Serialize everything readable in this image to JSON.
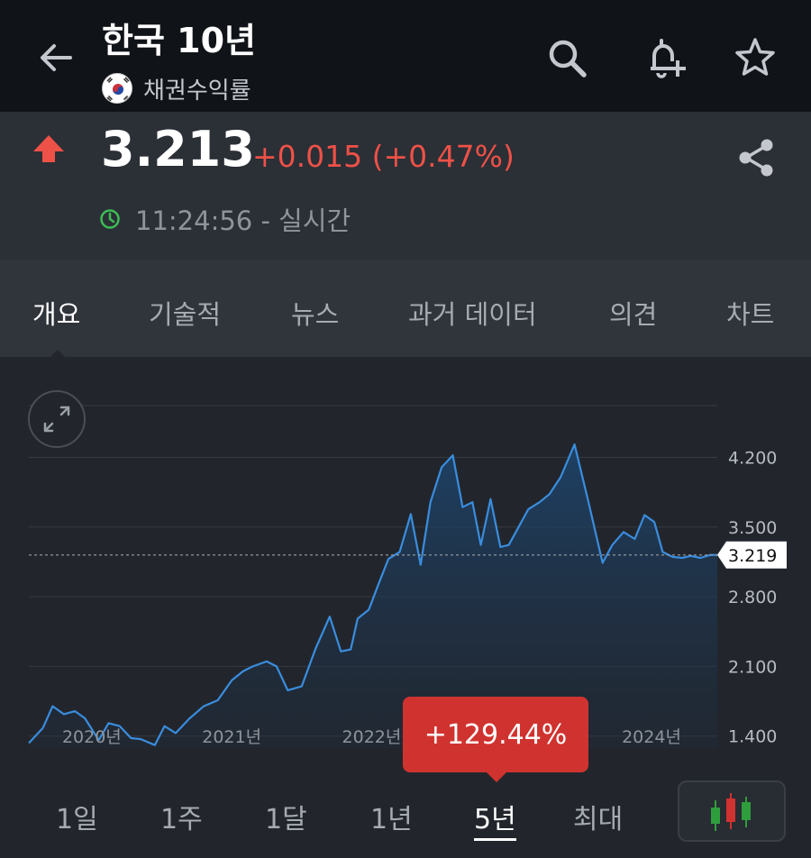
{
  "header": {
    "title": "한국 10년",
    "subtitle": "채권수익률",
    "icons": [
      "back-arrow-icon",
      "search-icon",
      "add-alert-icon",
      "star-icon"
    ]
  },
  "quote": {
    "price": "3.213",
    "change": "+0.015 (+0.47%)",
    "direction": "up",
    "time": "11:24:56 - 실시간",
    "colors": {
      "up": "#ee5147",
      "clock": "#3dbb55"
    }
  },
  "tabs": [
    "개요",
    "기술적",
    "뉴스",
    "과거 데이터",
    "의견",
    "차트"
  ],
  "active_tab": "개요",
  "ranges": [
    "1일",
    "1주",
    "1달",
    "1년",
    "5년",
    "최대"
  ],
  "active_range": "5년",
  "performance_badge": "+129.44%",
  "last_value_label": "3.219",
  "chart_data": {
    "type": "area",
    "x_tick_labels": [
      "2020년",
      "2021년",
      "2022년",
      "2024년"
    ],
    "y_tick_labels": [
      "4.200",
      "3.500",
      "2.800",
      "2.100",
      "1.400"
    ],
    "ylim": [
      1.28,
      4.72
    ],
    "xlim": [
      2019.55,
      2024.47
    ],
    "last_value": 3.219,
    "series": [
      {
        "x": [
          2019.55,
          2019.65,
          2019.72,
          2019.8,
          2019.88,
          2019.95,
          2020.05,
          2020.12,
          2020.2,
          2020.28,
          2020.35,
          2020.45,
          2020.52,
          2020.6,
          2020.7,
          2020.8,
          2020.9,
          2021.0,
          2021.08,
          2021.15,
          2021.25,
          2021.32,
          2021.4,
          2021.5,
          2021.6,
          2021.7,
          2021.78,
          2021.85,
          2021.9,
          2021.98,
          2022.05,
          2022.12,
          2022.2,
          2022.28,
          2022.35,
          2022.42,
          2022.5,
          2022.58,
          2022.65,
          2022.72,
          2022.78,
          2022.85,
          2022.92,
          2022.98,
          2023.05,
          2023.12,
          2023.2,
          2023.27,
          2023.35,
          2023.45,
          2023.55,
          2023.65,
          2023.72,
          2023.8,
          2023.88,
          2023.95,
          2024.02,
          2024.08,
          2024.15,
          2024.22,
          2024.28,
          2024.35,
          2024.42,
          2024.47
        ],
        "y": [
          1.33,
          1.48,
          1.7,
          1.62,
          1.65,
          1.58,
          1.36,
          1.53,
          1.5,
          1.38,
          1.37,
          1.31,
          1.5,
          1.43,
          1.58,
          1.7,
          1.76,
          1.96,
          2.05,
          2.1,
          2.15,
          2.1,
          1.86,
          1.9,
          2.28,
          2.6,
          2.25,
          2.27,
          2.58,
          2.67,
          2.93,
          3.18,
          3.25,
          3.63,
          3.12,
          3.75,
          4.1,
          4.22,
          3.7,
          3.75,
          3.32,
          3.78,
          3.3,
          3.32,
          3.5,
          3.68,
          3.75,
          3.83,
          4.0,
          4.33,
          3.75,
          3.14,
          3.32,
          3.45,
          3.38,
          3.62,
          3.55,
          3.25,
          3.2,
          3.19,
          3.21,
          3.19,
          3.22,
          3.219
        ],
        "color": "#3a8dde"
      }
    ]
  }
}
